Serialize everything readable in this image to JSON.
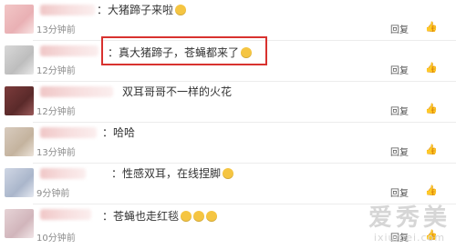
{
  "comments": [
    {
      "text": "：大猪蹄子来啦",
      "time": "13分钟前",
      "reply": "回复",
      "like": "👍"
    },
    {
      "text": "：真大猪蹄子，苍蝇都来了",
      "time": "12分钟前",
      "reply": "回复",
      "like": "👍"
    },
    {
      "text": "双耳哥哥不一样的火花",
      "time": "12分钟前",
      "reply": "回复",
      "like": "👍"
    },
    {
      "text": "：哈哈",
      "time": "13分钟前",
      "reply": "回复",
      "like": "👍"
    },
    {
      "text": "：性感双耳，在线捏脚",
      "time": "9分钟前",
      "reply": "回复",
      "like": "👍"
    },
    {
      "text": "：苍蝇也走红毯",
      "time": "10分钟前",
      "reply": "回复",
      "like": "👍"
    }
  ],
  "watermark": {
    "big": "爱秀美",
    "small": "ixiumei.com"
  },
  "colors": {
    "highlight": "#d8322f"
  }
}
